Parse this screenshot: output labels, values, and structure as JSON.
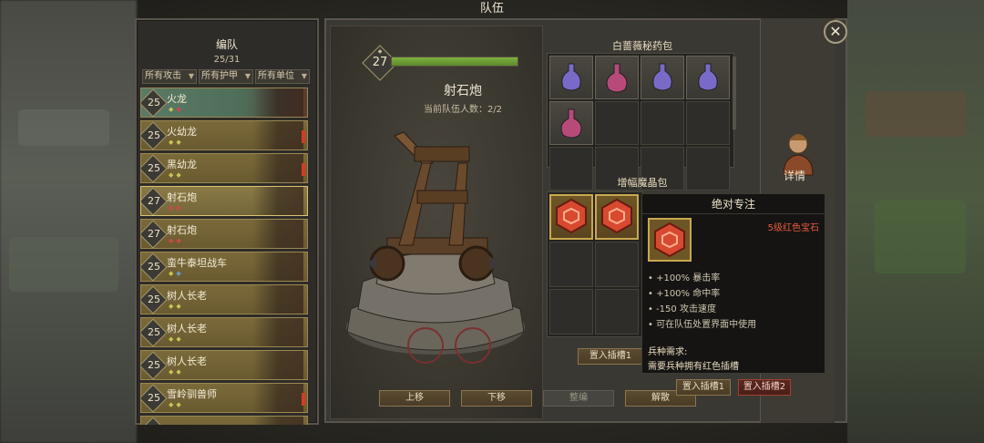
{
  "window": {
    "title": "队伍"
  },
  "roster": {
    "header": "编队",
    "count": "25/31",
    "filters": [
      "所有攻击",
      "所有护甲",
      "所有单位"
    ],
    "units": [
      {
        "level": "25",
        "name": "火龙",
        "gems": [
          "g",
          "r"
        ]
      },
      {
        "level": "25",
        "name": "火幼龙",
        "gems": [
          "g",
          "g"
        ],
        "warning": true
      },
      {
        "level": "25",
        "name": "黑幼龙",
        "gems": [
          "g",
          "g"
        ],
        "warning": true
      },
      {
        "level": "27",
        "name": "射石炮",
        "gems": [
          "r",
          "r"
        ],
        "selected": true
      },
      {
        "level": "27",
        "name": "射石炮",
        "gems": [
          "r",
          "r"
        ]
      },
      {
        "level": "25",
        "name": "蛮牛泰坦战车",
        "gems": [
          "g",
          "b"
        ]
      },
      {
        "level": "25",
        "name": "树人长老",
        "gems": [
          "g",
          "g"
        ]
      },
      {
        "level": "25",
        "name": "树人长老",
        "gems": [
          "g",
          "g"
        ]
      },
      {
        "level": "25",
        "name": "树人长老",
        "gems": [
          "g",
          "g"
        ]
      },
      {
        "level": "25",
        "name": "雪岭驯兽师",
        "gems": [
          "g",
          "g"
        ],
        "warning": true
      },
      {
        "level": "25",
        "name": "",
        "gems": []
      }
    ]
  },
  "unit_detail": {
    "level": "27",
    "name": "射石炮",
    "team_count": "当前队伍人数：2/2",
    "hp_fraction": 1.0
  },
  "potion_pack": {
    "title": "白蔷薇秘药包"
  },
  "gem_pack": {
    "title": "增幅魔晶包"
  },
  "buttons": {
    "move_up": "上移",
    "move_down": "下移",
    "edit": "整编",
    "disband": "解散",
    "slot1_inline": "置入插槽1",
    "slot1": "置入插槽1",
    "slot2": "置入插槽2"
  },
  "side": {
    "detail": "详情"
  },
  "tooltip": {
    "title": "绝对专注",
    "subtitle": "5级红色宝石",
    "effects": [
      "• +100% 暴击率",
      "• +100% 命中率",
      "• -150 攻击速度",
      "• 可在队伍处置界面中使用"
    ],
    "req_header": "兵种需求:",
    "req": "需要兵种拥有红色插槽"
  },
  "colors": {
    "gem_red": "#d04848",
    "gem_green": "#c8c456",
    "gem_blue": "#6a98c8",
    "tooltip_subtitle": "#e65a40"
  }
}
